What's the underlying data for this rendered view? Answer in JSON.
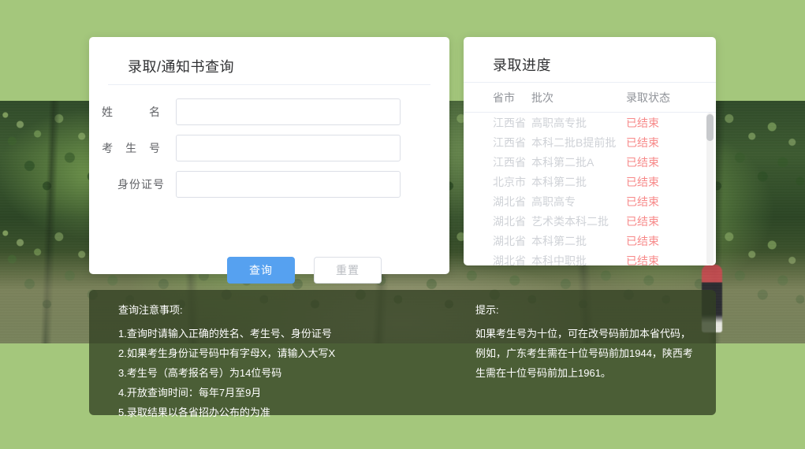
{
  "theme": {
    "page_bg": "#a4c77c",
    "card_bg": "#ffffff",
    "primary": "#56a1f0",
    "status_color": "#f78989",
    "label_color": "#606266",
    "notes_bg": "rgba(50,64,35,.78)"
  },
  "query_card": {
    "title": "录取/通知书查询",
    "fields": [
      {
        "label": "姓　　名",
        "value": "",
        "placeholder": ""
      },
      {
        "label": "考 生 号",
        "value": "",
        "placeholder": ""
      },
      {
        "label": "身份证号",
        "value": "",
        "placeholder": ""
      }
    ],
    "submit_label": "查询",
    "reset_label": "重置"
  },
  "progress_card": {
    "title": "录取进度",
    "columns": [
      "省市",
      "批次",
      "录取状态"
    ],
    "rows": [
      {
        "province": "江西省",
        "batch": "高职高专批",
        "status": "已结束"
      },
      {
        "province": "江西省",
        "batch": "本科二批B提前批",
        "status": "已结束"
      },
      {
        "province": "江西省",
        "batch": "本科第二批A",
        "status": "已结束"
      },
      {
        "province": "北京市",
        "batch": "本科第二批",
        "status": "已结束"
      },
      {
        "province": "湖北省",
        "batch": "高职高专",
        "status": "已结束"
      },
      {
        "province": "湖北省",
        "batch": "艺术类本科二批",
        "status": "已结束"
      },
      {
        "province": "湖北省",
        "batch": "本科第二批",
        "status": "已结束"
      },
      {
        "province": "湖北省",
        "batch": "本科中职批",
        "status": "已结束"
      }
    ]
  },
  "notes": {
    "left_title": "查询注意事项:",
    "left_lines": [
      "1.查询时请输入正确的姓名、考生号、身份证号",
      "2.如果考生身份证号码中有字母X，请输入大写X",
      "3.考生号（高考报名号）为14位号码",
      "4.开放查询时间：每年7月至9月",
      "5.录取结果以各省招办公布的为准"
    ],
    "right_title": "提示:",
    "right_text": "如果考生号为十位，可在改号码前加本省代码，例如，广东考生需在十位号码前加1944，陕西考生需在十位号码前加上1961。"
  }
}
